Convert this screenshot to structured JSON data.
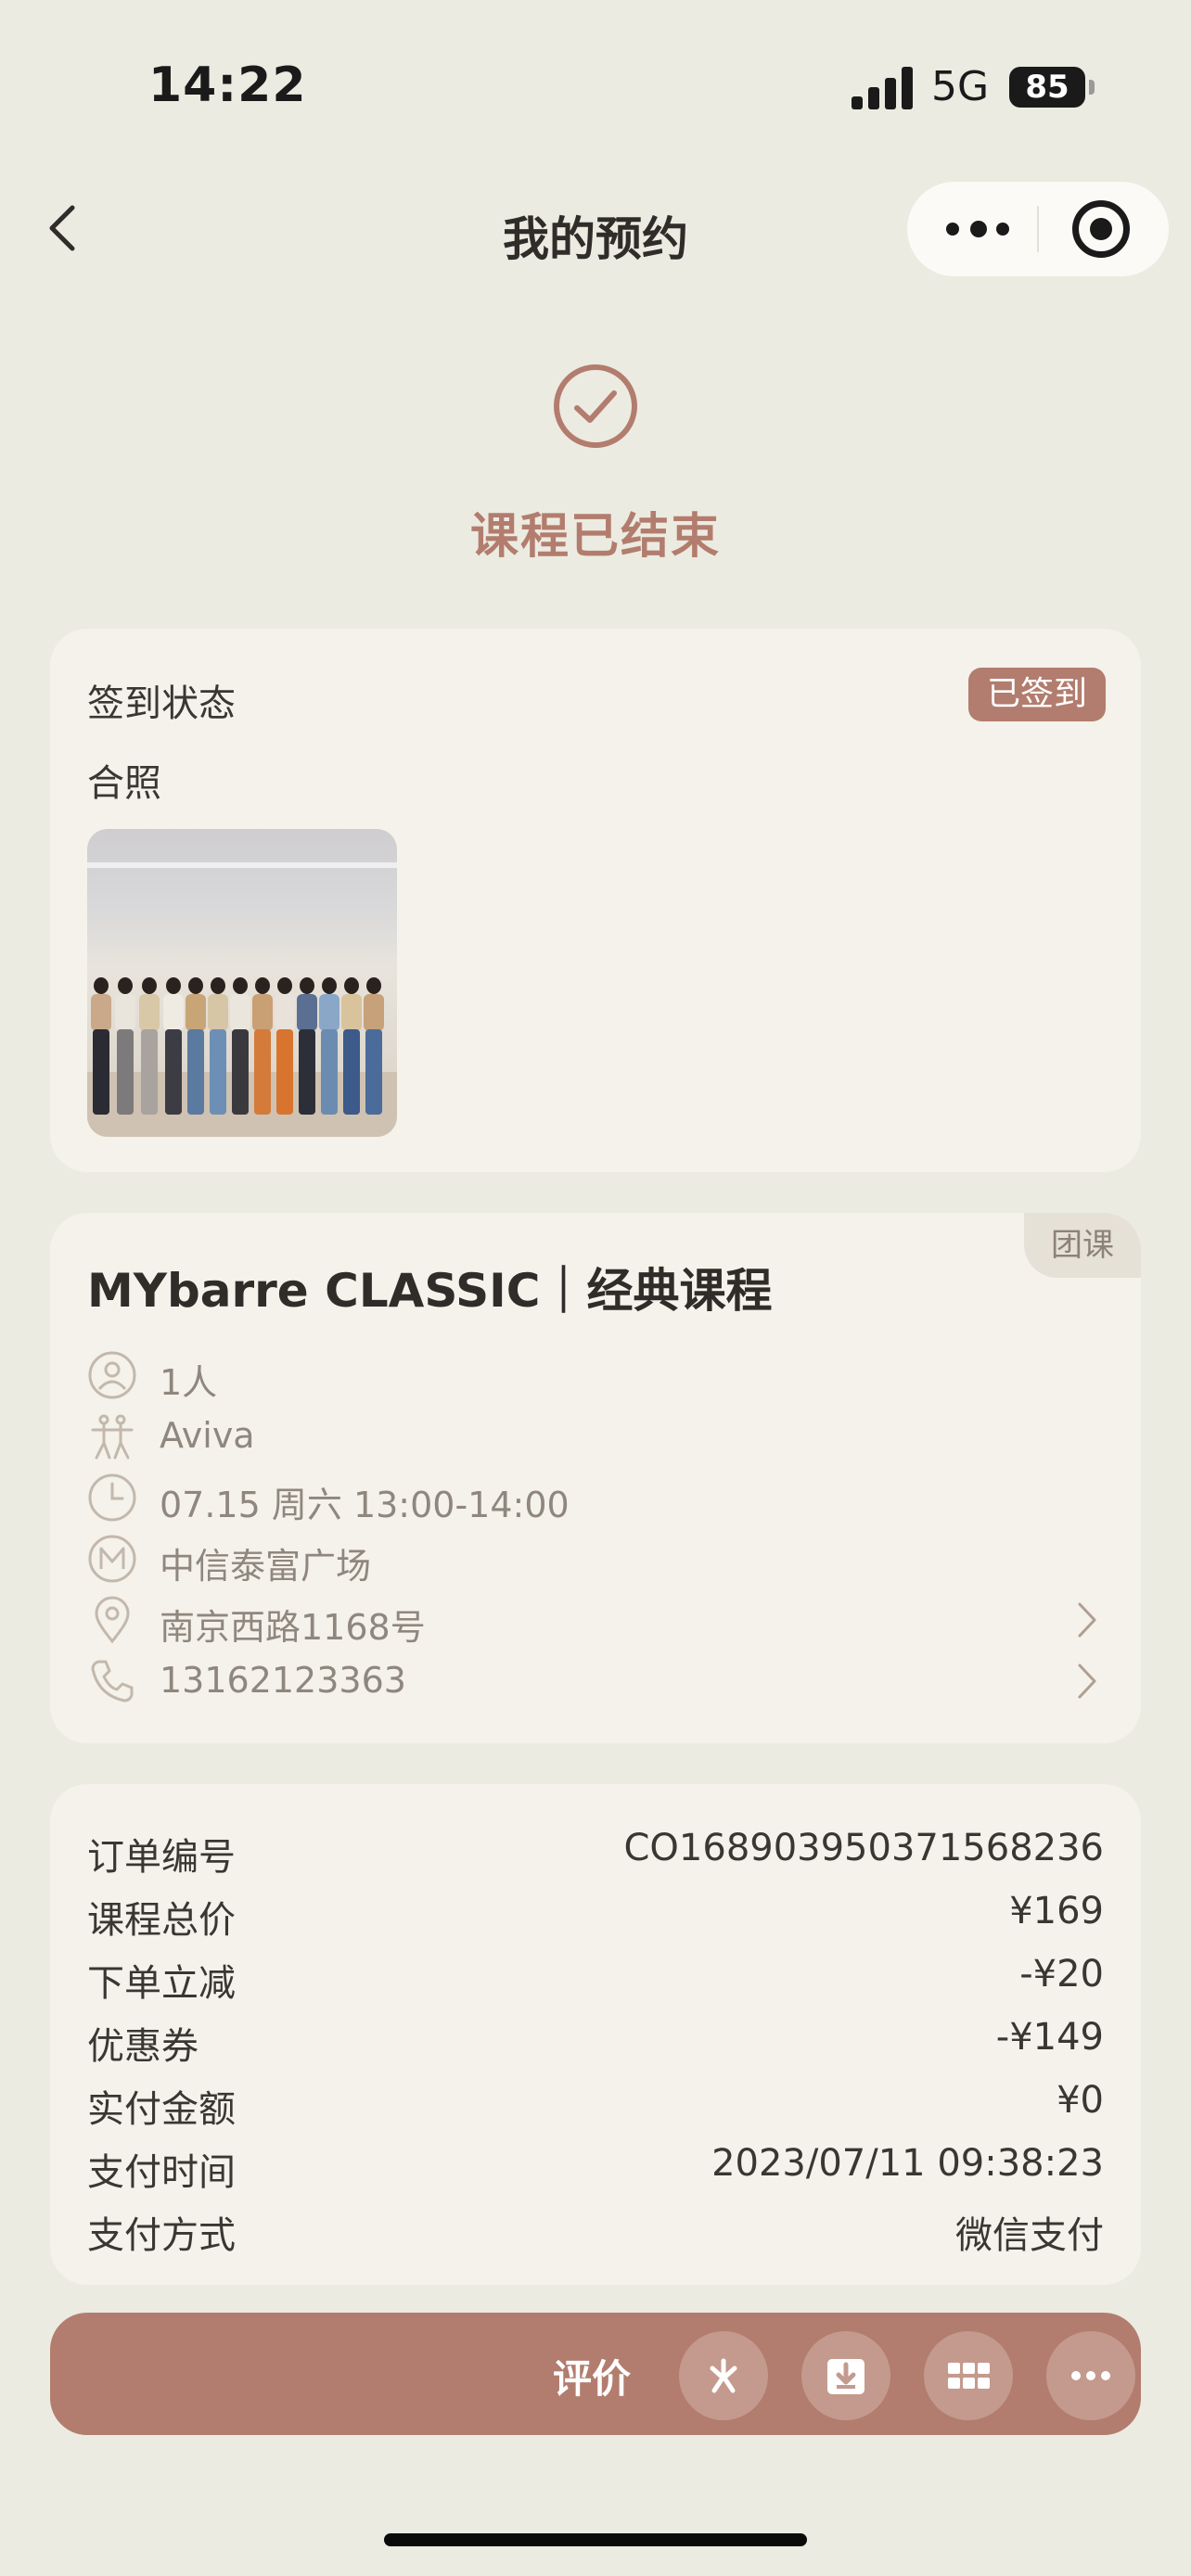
{
  "status_bar": {
    "time": "14:22",
    "network": "5G",
    "battery": "85"
  },
  "nav": {
    "title": "我的预约"
  },
  "status": {
    "text": "课程已结束"
  },
  "checkin_card": {
    "label": "签到状态",
    "badge": "已签到",
    "photo_label": "合照"
  },
  "course_card": {
    "tag": "团课",
    "title": "MYbarre CLASSIC｜经典课程",
    "rows": [
      {
        "icon": "person-icon",
        "text": "1人"
      },
      {
        "icon": "dancer-icon",
        "text": "Aviva"
      },
      {
        "icon": "clock-icon",
        "text": "07.15 周六 13:00-14:00"
      },
      {
        "icon": "studio-logo-icon",
        "text": "中信泰富广场"
      },
      {
        "icon": "location-pin-icon",
        "text": "南京西路1168号"
      },
      {
        "icon": "phone-icon",
        "text": "13162123363"
      }
    ]
  },
  "order_card": {
    "rows": [
      {
        "label": "订单编号",
        "value": "CO168903950371568236"
      },
      {
        "label": "课程总价",
        "value": "¥169"
      },
      {
        "label": "下单立减",
        "value": "-¥20"
      },
      {
        "label": "优惠券",
        "value": "-¥149"
      },
      {
        "label": "实付金额",
        "value": "¥0"
      },
      {
        "label": "支付时间",
        "value": "2023/07/11 09:38:23"
      },
      {
        "label": "支付方式",
        "value": "微信支付"
      }
    ]
  },
  "bottom_bar": {
    "review_label": "评价"
  },
  "colors": {
    "accent": "#b27d6e",
    "background": "#ecebe1",
    "card": "#f4f2ea",
    "muted_text": "#8f877e"
  }
}
